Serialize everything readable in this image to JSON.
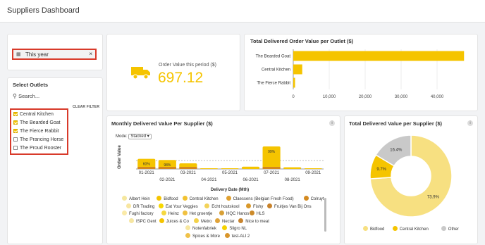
{
  "app": {
    "title": "Suppliers Dashboard"
  },
  "filters": {
    "date_value": "This year",
    "outlets_title": "Select Outlets",
    "search_placeholder": "Search...",
    "clear_label": "CLEAR FILTER",
    "outlets": [
      {
        "label": "Central Kitchen",
        "checked": true
      },
      {
        "label": "The Bearded Goat",
        "checked": true
      },
      {
        "label": "The Fierce Rabbit",
        "checked": true
      },
      {
        "label": "The Prancing Horse",
        "checked": false
      },
      {
        "label": "The Proud Rooster",
        "checked": false
      }
    ]
  },
  "kpi": {
    "label": "Order Value this period ($)",
    "value": "697.12"
  },
  "colors": {
    "accent": "#f5c400",
    "warn": "#d83a2a"
  },
  "outlet_chart": {
    "title": "Total Delivered Order Value per Outlet ($)",
    "chart_data": {
      "type": "bar",
      "orientation": "horizontal",
      "categories": [
        "The Bearded Goat",
        "Central Kitchen",
        "The Fierce Rabbit"
      ],
      "values": [
        47500,
        2500,
        500
      ],
      "xlim": [
        0,
        50000
      ],
      "xticks": [
        "0",
        "10,000",
        "20,000",
        "30,000",
        "40,000"
      ]
    }
  },
  "monthly_chart": {
    "title": "Monthly Delivered Value Per Supplier ($)",
    "mode_label": "Mode:",
    "mode_value": "Stacked",
    "chart_data": {
      "type": "bar",
      "stacked": true,
      "categories": [
        "01-2021",
        "02-2021",
        "03-2021",
        "04-2021",
        "05-2021",
        "06-2021",
        "07-2021",
        "08-2021",
        "09-2021"
      ],
      "values": [
        9,
        8,
        5,
        0.5,
        0.3,
        2,
        20,
        1.5,
        0.3
      ],
      "data_labels": [
        "60%",
        "98%",
        "",
        "",
        "",
        "",
        "99%",
        "",
        ""
      ],
      "xlabel": "Delivery Date (Mth)",
      "ylabel": "Order Value"
    },
    "legend": [
      {
        "name": "Albert Hein",
        "color": "#f5e79e"
      },
      {
        "name": "Bidfood",
        "color": "#f5c400"
      },
      {
        "name": "Central Kitchen",
        "color": "#f2c230"
      },
      {
        "name": "Claessens (Belgian Fresh Food)",
        "color": "#e0a030"
      },
      {
        "name": "Colruyt",
        "color": "#d48a20"
      },
      {
        "name": "DR Trading",
        "color": "#f8e6a0"
      },
      {
        "name": "Eat Your Veggies",
        "color": "#f7d700"
      },
      {
        "name": "Echt houtskool",
        "color": "#f3d35a"
      },
      {
        "name": "Fishy",
        "color": "#d9982a"
      },
      {
        "name": "Fruitjes Van Bij Ons",
        "color": "#c8822a"
      },
      {
        "name": "Fughi factory",
        "color": "#faeaa8"
      },
      {
        "name": "Heinz",
        "color": "#f5d840"
      },
      {
        "name": "Het groentje",
        "color": "#f0c040"
      },
      {
        "name": "HQC Hanos",
        "color": "#d8a036"
      },
      {
        "name": "HLS",
        "color": "#cc8a2a"
      },
      {
        "name": "ISPC Gent",
        "color": "#f6e6a2"
      },
      {
        "name": "Juices & Co",
        "color": "#f5c400"
      },
      {
        "name": "Metro",
        "color": "#f3d24a"
      },
      {
        "name": "Nectar",
        "color": "#e0a33a"
      },
      {
        "name": "Nice to meat",
        "color": "#c8842e"
      },
      {
        "name": "Notenfabriek",
        "color": "#f7e7a0"
      },
      {
        "name": "Sligro NL",
        "color": "#f5d200"
      },
      {
        "name": "Spices & More",
        "color": "#f0c24a"
      },
      {
        "name": "test-ALI 2",
        "color": "#d9962c"
      }
    ]
  },
  "supplier_chart": {
    "title": "Total Delivered Value per Supplier ($)",
    "chart_data": {
      "type": "pie",
      "donut": true,
      "categories": [
        "Bidfood",
        "Central Kitchen",
        "Other"
      ],
      "values": [
        73.9,
        9.7,
        16.4
      ],
      "data_labels": [
        "73.9%",
        "9.7%",
        "16.4%"
      ],
      "colors": [
        "#f7e081",
        "#f5c400",
        "#c9c9c9"
      ]
    }
  }
}
